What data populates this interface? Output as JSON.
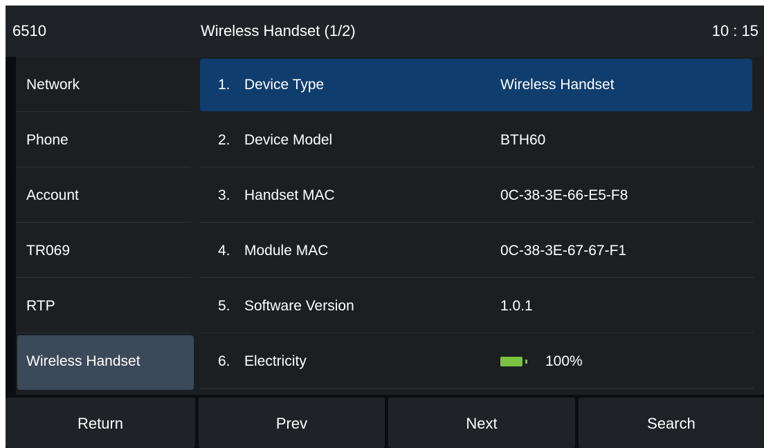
{
  "titlebar": {
    "left": "6510",
    "center": "Wireless Handset (1/2)",
    "right": "10 : 15"
  },
  "sidebar": {
    "items": [
      {
        "label": "Network"
      },
      {
        "label": "Phone"
      },
      {
        "label": "Account"
      },
      {
        "label": "TR069"
      },
      {
        "label": "RTP"
      },
      {
        "label": "Wireless Handset",
        "selected": true
      }
    ]
  },
  "content": {
    "rows": [
      {
        "num": "1.",
        "name": "Device Type",
        "value": "Wireless Handset",
        "selected": true
      },
      {
        "num": "2.",
        "name": "Device Model",
        "value": "BTH60"
      },
      {
        "num": "3.",
        "name": "Handset MAC",
        "value": "0C-38-3E-66-E5-F8"
      },
      {
        "num": "4.",
        "name": "Module MAC",
        "value": "0C-38-3E-67-67-F1"
      },
      {
        "num": "5.",
        "name": "Software Version",
        "value": "1.0.1"
      },
      {
        "num": "6.",
        "name": "Electricity",
        "value": "100%",
        "icon": "battery-icon",
        "battery_level": 1.0
      }
    ]
  },
  "softkeys": {
    "return": "Return",
    "prev": "Prev",
    "next": "Next",
    "search": "Search"
  },
  "colors": {
    "selected_row": "#0f3d6e",
    "selected_sidebar": "#3b4958",
    "battery": "#7cc242",
    "panel": "#1b1f22",
    "bar": "#1f2327"
  }
}
